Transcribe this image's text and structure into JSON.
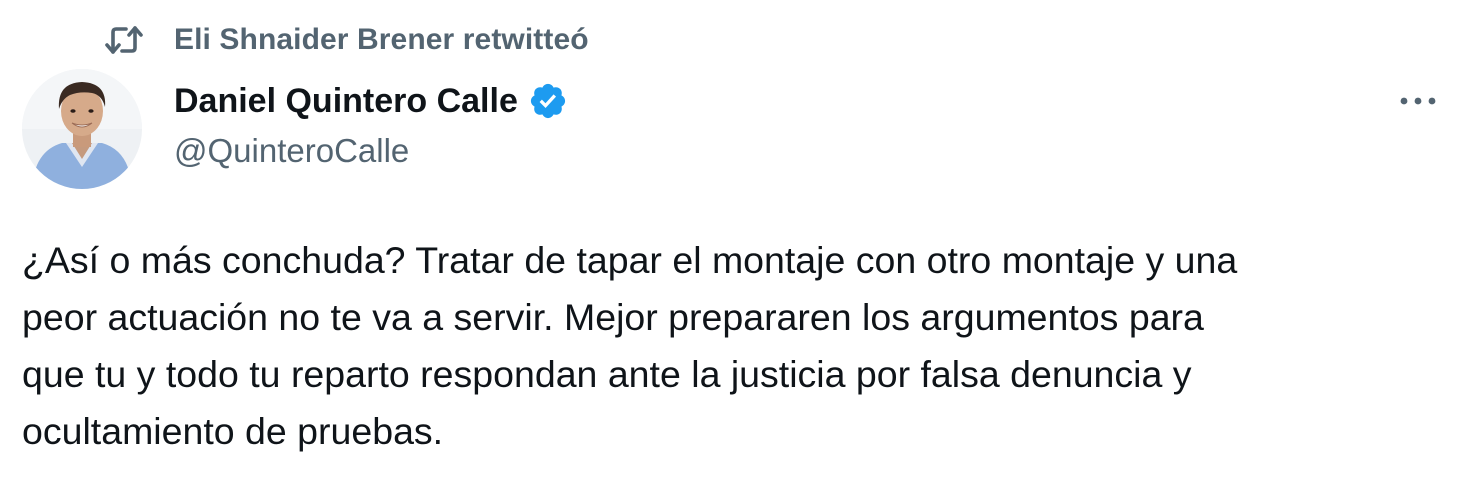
{
  "social_context": {
    "icon": "retweet-icon",
    "text": "Eli Shnaider Brener retwitteó"
  },
  "author": {
    "display_name": "Daniel Quintero Calle",
    "handle": "@QuinteroCalle",
    "verified": true,
    "verified_color": "#1d9bf0",
    "avatar": "avatar-photo"
  },
  "tweet": {
    "text": "¿Así o más conchuda? Tratar de tapar el montaje con otro montaje y una\npeor actuación no te va a servir. Mejor prepararen los argumentos para\nque tu y todo tu reparto respondan ante la justicia por falsa denuncia y\nocultamiento de pruebas."
  },
  "actions": {
    "more_icon": "more-icon"
  },
  "colors": {
    "primary_text": "#0f1419",
    "secondary_text": "#536471",
    "background": "#ffffff"
  }
}
